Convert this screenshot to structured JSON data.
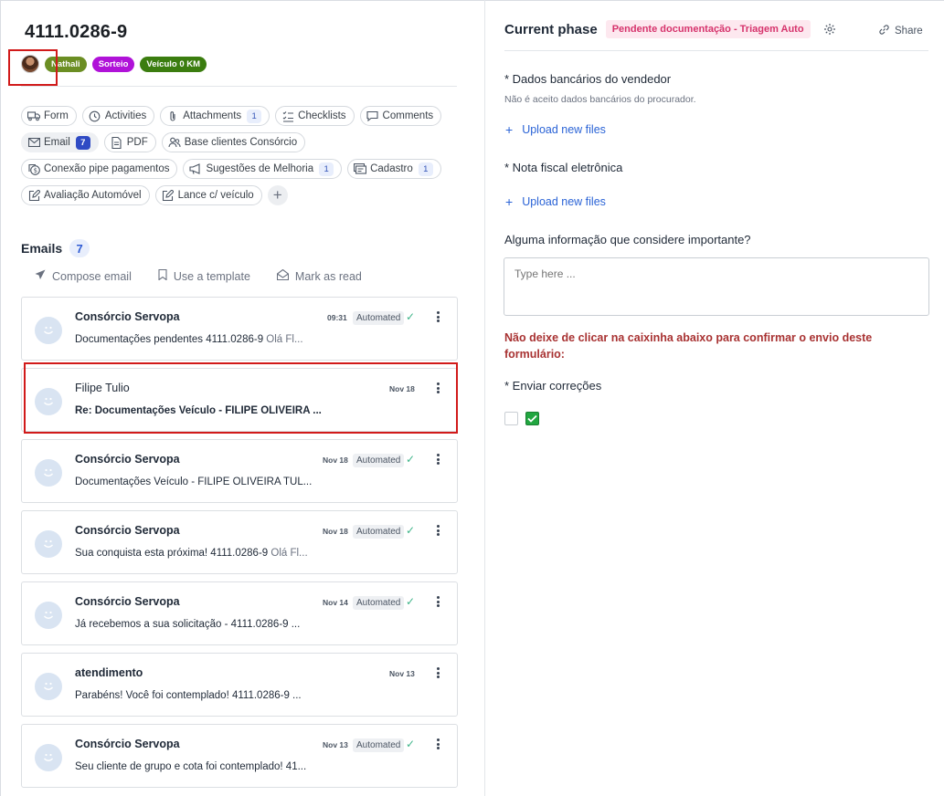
{
  "card": {
    "title": "4111.0286-9",
    "labels": [
      {
        "text": "Nathali",
        "color": "#6b8e23"
      },
      {
        "text": "Sorteio",
        "color": "#b012d8"
      },
      {
        "text": "Veículo 0 KM",
        "color": "#3b7d0f"
      }
    ]
  },
  "chips": {
    "row1": [
      {
        "label": "Form",
        "icon": "truck-icon"
      },
      {
        "label": "Activities",
        "icon": "history-icon"
      },
      {
        "label": "Attachments",
        "icon": "paperclip-icon",
        "count": "1"
      },
      {
        "label": "Checklists",
        "icon": "checklist-icon"
      },
      {
        "label": "Comments",
        "icon": "comment-icon"
      }
    ],
    "row2": [
      {
        "label": "Email",
        "icon": "mail-icon",
        "count": "7"
      },
      {
        "label": "PDF",
        "icon": "document-icon"
      },
      {
        "label": "Base clientes Consórcio",
        "icon": "users-icon"
      }
    ],
    "row3": [
      {
        "label": "Conexão pipe pagamentos",
        "icon": "money-icon"
      },
      {
        "label": "Sugestões de Melhoria",
        "icon": "megaphone-icon",
        "count": "1"
      },
      {
        "label": "Cadastro",
        "icon": "card-icon",
        "count": "1"
      }
    ],
    "row4": [
      {
        "label": "Avaliação Automóvel",
        "icon": "edit-icon"
      },
      {
        "label": "Lance c/ veículo",
        "icon": "edit-icon"
      }
    ]
  },
  "emails": {
    "title": "Emails",
    "count": "7",
    "actions": {
      "compose": "Compose email",
      "template": "Use a template",
      "mark_read": "Mark as read"
    },
    "automated_label": "Automated",
    "items": [
      {
        "sender": "Consórcio Servopa",
        "date": "09:31",
        "automated": true,
        "subject": "Documentações pendentes 4111.0286-9",
        "preview": " Olá Fl..."
      },
      {
        "sender": "Filipe Tulio",
        "date": "Nov 18",
        "automated": false,
        "subject": "Re: Documentações Veículo - FILIPE OLIVEIRA ...",
        "preview": ""
      },
      {
        "sender": "Consórcio Servopa",
        "date": "Nov 18",
        "automated": true,
        "subject": "Documentações Veículo - FILIPE OLIVEIRA TUL...",
        "preview": ""
      },
      {
        "sender": "Consórcio Servopa",
        "date": "Nov 18",
        "automated": true,
        "subject": "Sua conquista esta próxima! 4111.0286-9",
        "preview": " Olá Fl..."
      },
      {
        "sender": "Consórcio Servopa",
        "date": "Nov 14",
        "automated": true,
        "subject": "Já recebemos a sua solicitação - 4111.0286-9 ...",
        "preview": ""
      },
      {
        "sender": "atendimento",
        "date": "Nov 13",
        "automated": false,
        "subject": "Parabéns! Você foi contemplado! 4111.0286-9 ...",
        "preview": ""
      },
      {
        "sender": "Consórcio Servopa",
        "date": "Nov 13",
        "automated": true,
        "subject": "Seu cliente de grupo e cota foi contemplado! 41...",
        "preview": ""
      }
    ]
  },
  "phase": {
    "title": "Current phase",
    "badge": "Pendente documentação - Triagem Auto",
    "share": "Share"
  },
  "form": {
    "bank_label": "* Dados bancários do vendedor",
    "bank_help": "Não é aceito dados bancários do procurador.",
    "upload_label": "Upload new files",
    "invoice_label": "* Nota fiscal eletrônica",
    "info_label": "Alguma informação que considere importante?",
    "info_placeholder": "Type here ...",
    "warning": "Não deixe de clicar na caixinha abaixo para confirmar o envio deste formulário:",
    "corrections_label": "* Enviar correções"
  },
  "colors": {
    "accent": "#2a63d6",
    "phase_badge_bg": "#fde8ef",
    "phase_badge_text": "#d6336c",
    "warning": "#a83232",
    "checked": "#21a640",
    "highlight": "#d11a1a"
  }
}
